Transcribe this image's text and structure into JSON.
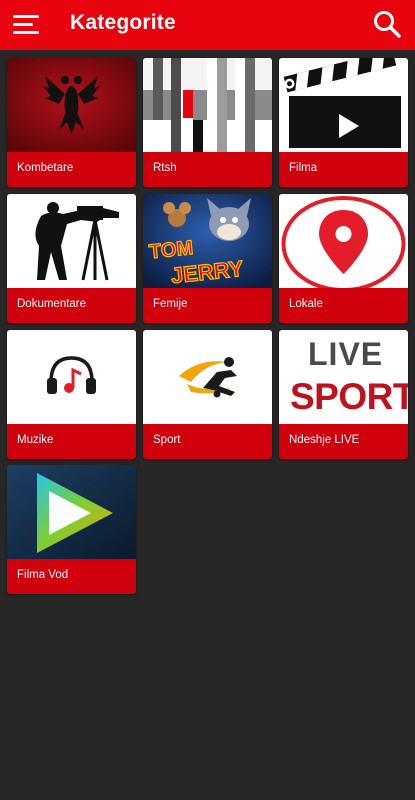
{
  "appbar": {
    "title": "Kategorite",
    "menu_icon": "hamburger-menu-icon",
    "search_icon": "search-icon",
    "background": "#e8040f"
  },
  "colors": {
    "page_background": "#272727",
    "card_label_background": "#d0000c",
    "text": "#ffffff"
  },
  "categories": [
    {
      "label": "Kombetare",
      "image": "albanian-flag-eagle"
    },
    {
      "label": "Rtsh",
      "image": "rtsh-logo"
    },
    {
      "label": "Filma",
      "image": "clapperboard"
    },
    {
      "label": "Dokumentare",
      "image": "cameraman-silhouette"
    },
    {
      "label": "Femije",
      "image": "tom-and-jerry"
    },
    {
      "label": "Lokale",
      "image": "location-pin"
    },
    {
      "label": "Muzike",
      "image": "music-headphones"
    },
    {
      "label": "Sport",
      "image": "soccer-kick"
    },
    {
      "label": "Ndeshje LIVE",
      "image": "live-sport-text",
      "image_text": [
        "LIVE",
        "SPORT"
      ]
    },
    {
      "label": "Filma Vod",
      "image": "play-button"
    }
  ]
}
